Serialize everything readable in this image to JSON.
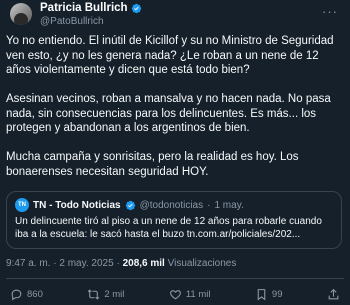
{
  "author": {
    "name": "Patricia Bullrich",
    "handle": "@PatoBullrich"
  },
  "more_glyph": "···",
  "body": {
    "p1": "Yo no entiendo. El inútil de Kicillof y su no Ministro de Seguridad ven esto, ¿y no les genera nada? ¿Le roban a un nene de 12 años violentamente y dicen que está todo bien?",
    "p2": "Asesinan vecinos, roban a mansalva y no hacen nada. No pasa nada, sin consecuencias para los delincuentes. Es más... los protegen y abandonan a los argentinos de bien.",
    "p3": "Mucha campaña y sonrisitas, pero la realidad es hoy. Los bonaerenses necesitan seguridad HOY."
  },
  "quote": {
    "logo_text": "TN",
    "name": "TN - Todo Noticias",
    "handle": "@todonoticias",
    "separator": "·",
    "date": "1 may.",
    "text": "Un delincuente tiró al piso a un nene de 12 años para robarle cuando iba a la escuela: le sacó hasta el buzo tn.com.ar/policiales/202..."
  },
  "meta": {
    "time": "9:47 a. m.",
    "dot1": "·",
    "date": "2 may. 2025",
    "dot2": "·",
    "views_count": "208,6 mil",
    "views_label": "Visualizaciones"
  },
  "actions": {
    "reply_count": "860",
    "retweet_count": "2 mil",
    "like_count": "11 mil",
    "bookmark_count": "99"
  },
  "colors": {
    "background": "#15202b",
    "secondary_text": "#8b98a5",
    "verified": "#1d9bf0",
    "border": "#38444d"
  }
}
